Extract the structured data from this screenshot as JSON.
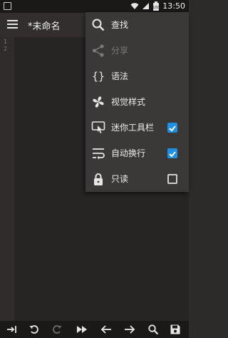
{
  "status_bar": {
    "time": "13:50",
    "battery": "100"
  },
  "app_bar": {
    "title": "*未命名"
  },
  "editor": {
    "line_numbers": [
      "1",
      "2"
    ]
  },
  "menu": {
    "items": [
      {
        "label": "查找",
        "icon": "search-icon",
        "enabled": true
      },
      {
        "label": "分享",
        "icon": "share-icon",
        "enabled": false
      },
      {
        "label": "语法",
        "icon": "braces-icon",
        "enabled": true
      },
      {
        "label": "视觉样式",
        "icon": "fan-icon",
        "enabled": true
      },
      {
        "label": "迷你工具栏",
        "icon": "touch-toolbar-icon",
        "enabled": true,
        "checked": true
      },
      {
        "label": "自动换行",
        "icon": "wrap-icon",
        "enabled": true,
        "checked": true
      },
      {
        "label": "只读",
        "icon": "lock-icon",
        "enabled": true,
        "checked": false
      }
    ]
  },
  "bottom_toolbar": [
    "tab-icon",
    "undo-icon",
    "redo-icon",
    "fast-forward-icon",
    "arrow-left-icon",
    "arrow-right-icon",
    "search-icon",
    "save-icon"
  ],
  "colors": {
    "accent": "#1e90e4",
    "menu_bg": "#3b3838",
    "editor_bg": "#272424"
  }
}
